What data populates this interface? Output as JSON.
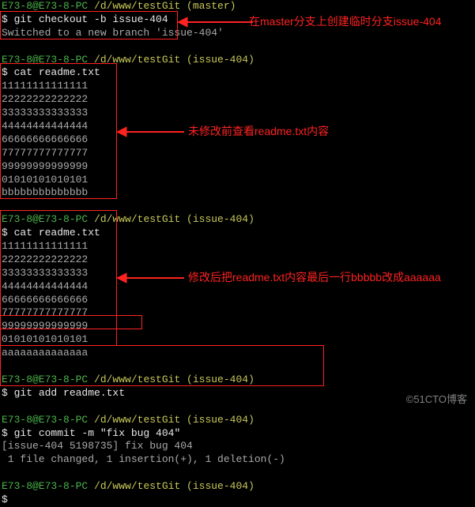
{
  "prompt": {
    "user_host": "E73-8@E73-8-PC",
    "path_master": "/d/www/testGit (master)",
    "path_branch": "/d/www/testGit (issue-404)"
  },
  "block1": {
    "cmd": "git checkout -b issue-404",
    "out": "Switched to a new branch 'issue-404'"
  },
  "block2": {
    "cmd": "cat readme.txt",
    "lines": [
      "11111111111111",
      "22222222222222",
      "33333333333333",
      "44444444444444",
      "66666666666666",
      "77777777777777",
      "99999999999999",
      "01010101010101",
      "bbbbbbbbbbbbbb"
    ]
  },
  "block3": {
    "cmd": "cat readme.txt",
    "lines": [
      "11111111111111",
      "22222222222222",
      "33333333333333",
      "44444444444444",
      "66666666666666",
      "77777777777777",
      "99999999999999",
      "01010101010101",
      "aaaaaaaaaaaaaa"
    ]
  },
  "block4": {
    "cmd": "git add readme.txt"
  },
  "block5": {
    "cmd": "git commit -m \"fix bug 404\"",
    "out1": "[issue-404 5198735] fix bug 404",
    "out2": " 1 file changed, 1 insertion(+), 1 deletion(-)"
  },
  "anno": {
    "a1": "在master分支上创建临时分支issue-404",
    "a2": "未修改前查看readme.txt内容",
    "a3": "修改后把readme.txt内容最后一行bbbbb改成aaaaaa"
  },
  "watermark": "©51CTO博客"
}
